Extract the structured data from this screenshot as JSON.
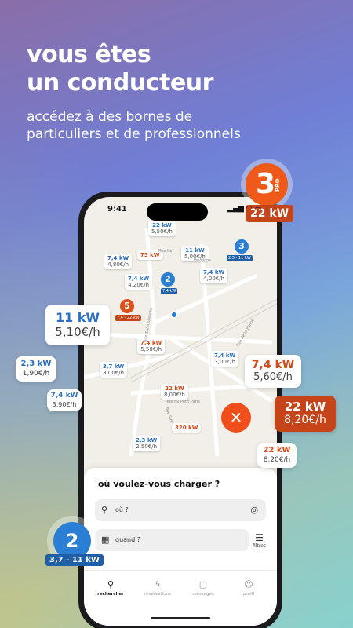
{
  "headline": [
    "vous êtes",
    "un conducteur"
  ],
  "subline": "accédez à des bornes de particuliers et de professionnels",
  "status_bar": {
    "time": "9:41"
  },
  "map": {
    "pins": [
      {
        "kw": "22 kW",
        "price": "5,50€/h",
        "color": "blue"
      },
      {
        "kw": "11 kW",
        "price": "5,00€/h",
        "color": "blue"
      },
      {
        "kw": "7,4 kW",
        "price": "4,80€/h",
        "color": "blue"
      },
      {
        "kw": "75 kW",
        "price": "",
        "color": "orange"
      },
      {
        "kw": "7,4 kW",
        "price": "4,20€/h",
        "color": "blue"
      },
      {
        "kw": "7,4 kW",
        "price": "4,00€/h",
        "color": "blue"
      },
      {
        "kw": "7,4 kW",
        "price": "5,50€/h",
        "color": "orange"
      },
      {
        "kw": "3,7 kW",
        "price": "3,00€/h",
        "color": "blue"
      },
      {
        "kw": "7,4 kW",
        "price": "3,00€/h",
        "color": "blue"
      },
      {
        "kw": "22 kW",
        "price": "8,00€/h",
        "color": "orange"
      },
      {
        "kw": "320 kW",
        "price": "",
        "color": "orange"
      },
      {
        "kw": "2,3 kW",
        "price": "2,50€/h",
        "color": "blue"
      }
    ],
    "clusters": [
      {
        "count": "3",
        "tag": "2,3 - 11 kW",
        "color": "#2a7fd4"
      },
      {
        "count": "2",
        "tag": "7,4 kW",
        "color": "#2a7fd4"
      },
      {
        "count": "5",
        "tag": "7,4 - 22 kW",
        "color": "#e0501c"
      }
    ],
    "streets": [
      "Rue Bel",
      "Pavillons",
      "Rue Saint Gervais",
      "Rue de la Plaine",
      "Rue du Petit Paris",
      "Rue Sire"
    ],
    "close_icon": "close-icon"
  },
  "search_sheet": {
    "title": "où voulez-vous charger ?",
    "where_placeholder": "où ?",
    "when_placeholder": "quand ?",
    "filters_label": "filtres"
  },
  "tabs": [
    {
      "label": "rechercher",
      "icon": "search-icon",
      "active": true
    },
    {
      "label": "réservations",
      "icon": "bolt-icon",
      "active": false
    },
    {
      "label": "messages",
      "icon": "message-icon",
      "active": false
    },
    {
      "label": "profil",
      "icon": "profile-icon",
      "active": false
    }
  ],
  "floating_cards": [
    {
      "kw": "11 kW",
      "price": "5,10€/h",
      "color": "blue"
    },
    {
      "kw": "2,3 kW",
      "price": "1,90€/h",
      "color": "blue"
    },
    {
      "kw": "7,4 kW",
      "price": "3,90€/h",
      "color": "blue"
    },
    {
      "kw": "7,4 kW",
      "price": "5,60€/h",
      "color": "orange"
    },
    {
      "kw": "22 kW",
      "price": "8,20€/h",
      "color": "dark"
    },
    {
      "kw": "22 kW",
      "price": "8,20€/h",
      "color": "orange"
    }
  ],
  "pro_badge": {
    "count": "3",
    "label": "PRO",
    "power": "22 kW"
  },
  "cluster_badge": {
    "count": "2",
    "power": "3,7 - 11 kW"
  },
  "colors": {
    "accent_orange": "#ef5a1a",
    "accent_blue": "#2a7fd4",
    "dark_orange": "#c6441a"
  }
}
